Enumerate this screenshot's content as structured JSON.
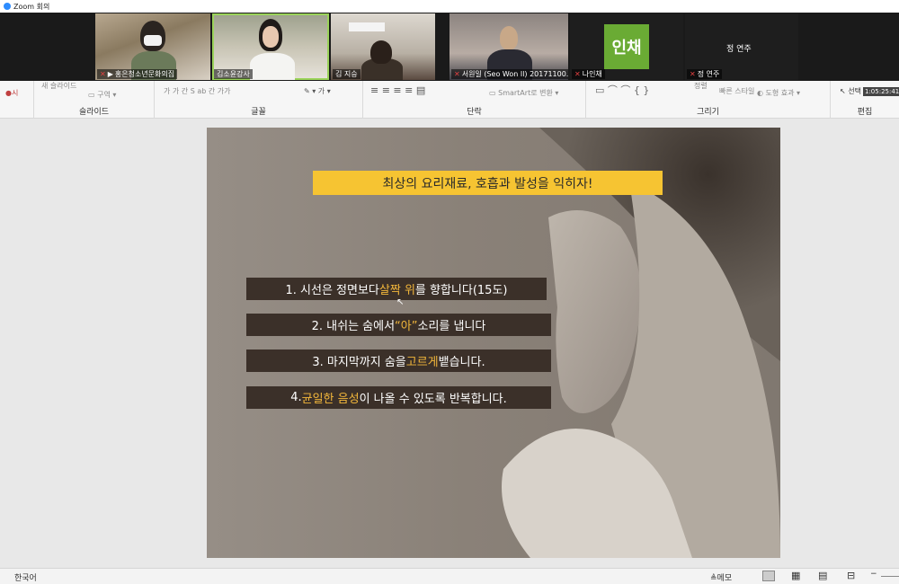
{
  "window": {
    "title": "Zoom 회의"
  },
  "participants": [
    {
      "name": "홍은청소년문화의집"
    },
    {
      "name": "김소윤강사"
    },
    {
      "name": "김 지승"
    },
    {
      "name": "서원일 (Seo Won Il) 20171100..."
    },
    {
      "name": "나인채",
      "avatar_text": "인채",
      "avatar_color": "#6aab34"
    },
    {
      "name": "정 연주"
    }
  ],
  "ribbon": {
    "slide_group": {
      "label": "슬라이드",
      "new": "새 슬라이드",
      "section": "구역"
    },
    "font_group": {
      "label": "글꼴"
    },
    "paragraph_group": {
      "label": "단락",
      "smartart": "SmartArt로 변환"
    },
    "drawing_group": {
      "label": "그리기",
      "arrange": "정렬",
      "quick_styles": "빠른 스타일",
      "shape_effects": "도형 효과"
    },
    "editing_group": {
      "label": "편집",
      "select": "선택"
    },
    "timer": "1:05:25:41"
  },
  "slide": {
    "title": "최상의 요리재료, 호흡과 발성을 익히자!",
    "steps": [
      {
        "before": "1. 시선은 정면보다 ",
        "highlight": "살짝 위",
        "after": "를 향합니다(15도)"
      },
      {
        "before": "2. 내쉬는 숨에서 ",
        "highlight": "“아”",
        "after": "소리를 냅니다"
      },
      {
        "before": "3. 마지막까지 숨을 ",
        "highlight": "고르게",
        "after": " 뱉습니다."
      },
      {
        "before": "4. ",
        "highlight": "균일한 음성",
        "after": "이 나올 수 있도록 반복합니다."
      }
    ],
    "highlight_color": "#f3b73b",
    "bar_color": "#3b3029",
    "title_bg": "#f6c432"
  },
  "statusbar": {
    "language": "한국어",
    "notes": "메모"
  }
}
